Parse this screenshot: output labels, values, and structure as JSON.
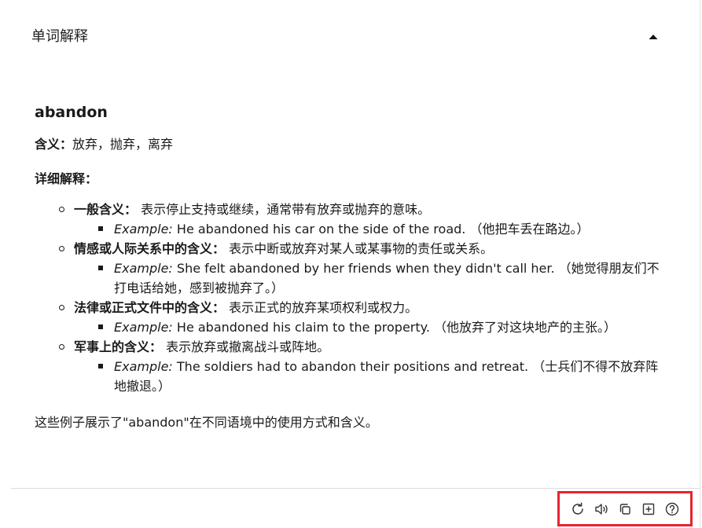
{
  "header": {
    "title": "单词解释",
    "collapse_icon": "caret-up-icon"
  },
  "entry": {
    "word": "abandon",
    "meaning_label": "含义：",
    "meaning_text": "放弃，抛弃，离弃",
    "detail_label": "详细解释：",
    "senses": [
      {
        "label": "一般含义：",
        "text": "表示停止支持或继续，通常带有放弃或抛弃的意味。",
        "example_label": "Example:",
        "example_text": "He abandoned his car on the side of the road. （他把车丢在路边。）"
      },
      {
        "label": "情感或人际关系中的含义：",
        "text": "表示中断或放弃对某人或某事物的责任或关系。",
        "example_label": "Example:",
        "example_text": "She felt abandoned by her friends when they didn't call her. （她觉得朋友们不打电话给她，感到被抛弃了。）"
      },
      {
        "label": "法律或正式文件中的含义：",
        "text": "表示正式的放弃某项权利或权力。",
        "example_label": "Example:",
        "example_text": "He abandoned his claim to the property. （他放弃了对这块地产的主张。）"
      },
      {
        "label": "军事上的含义：",
        "text": "表示放弃或撤离战斗或阵地。",
        "example_label": "Example:",
        "example_text": "The soldiers had to abandon their positions and retreat. （士兵们不得不放弃阵地撤退。）"
      }
    ],
    "summary": "这些例子展示了\"abandon\"在不同语境中的使用方式和含义。"
  },
  "toolbar": {
    "highlight_color": "#e8242f",
    "icons": [
      "refresh-icon",
      "speaker-icon",
      "copy-icon",
      "add-icon",
      "help-icon"
    ]
  }
}
